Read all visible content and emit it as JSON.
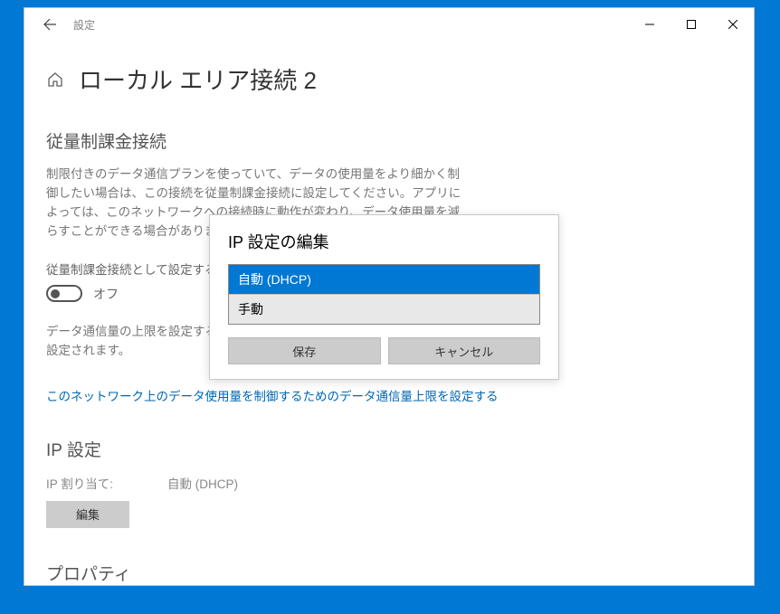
{
  "titlebar": {
    "app_name": "設定"
  },
  "page": {
    "title": "ローカル エリア接続 2"
  },
  "metered": {
    "section_title": "従量制課金接続",
    "description": "制限付きのデータ通信プランを使っていて、データの使用量をより細かく制御したい場合は、この接続を従量制課金接続に設定してください。アプリによっては、このネットワークへの接続時に動作が変わり、データ使用量を減らすことができる場合があります。",
    "toggle_label": "従量制課金接続として設定する",
    "toggle_state": "オフ",
    "limit_text": "データ通信量の上限を設定すると、上限を超えないように従量制課金接続が設定されます。",
    "link_text": "このネットワーク上のデータ使用量を制御するためのデータ通信量上限を設定する"
  },
  "ip": {
    "section_title": "IP 設定",
    "assign_label": "IP 割り当て:",
    "assign_value": "自動 (DHCP)",
    "edit_label": "編集"
  },
  "props": {
    "section_title": "プロパティ"
  },
  "dialog": {
    "title": "IP 設定の編集",
    "option_auto": "自動 (DHCP)",
    "option_manual": "手動",
    "save": "保存",
    "cancel": "キャンセル"
  }
}
